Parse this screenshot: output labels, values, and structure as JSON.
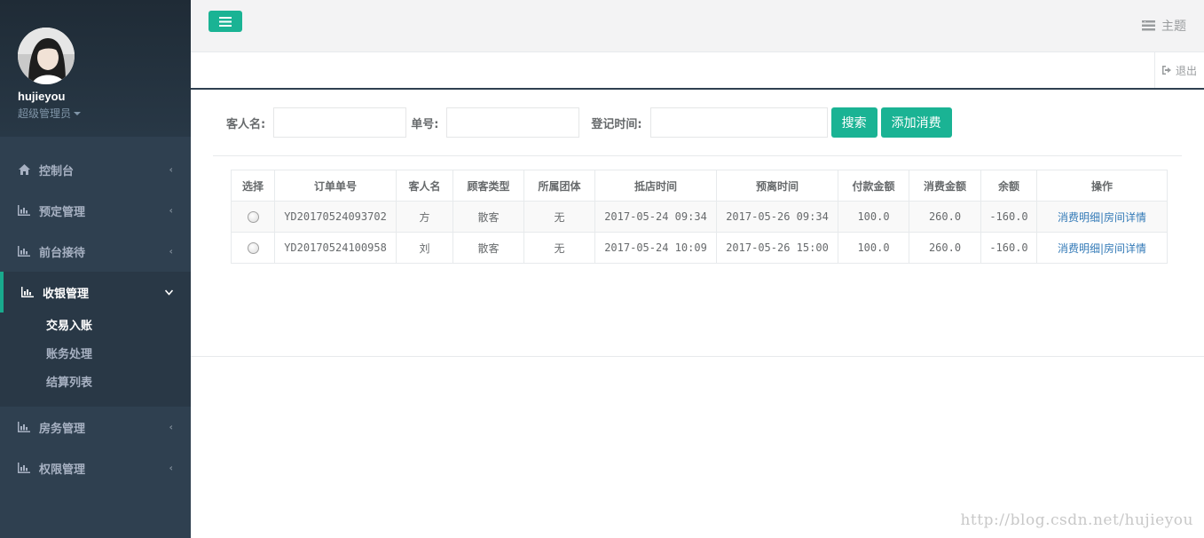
{
  "user": {
    "name": "hujieyou",
    "role": "超级管理员"
  },
  "nav": {
    "items": [
      {
        "label": "控制台",
        "icon": "home-icon"
      },
      {
        "label": "预定管理",
        "icon": "bar-chart-icon"
      },
      {
        "label": "前台接待",
        "icon": "bar-chart-icon"
      },
      {
        "label": "收银管理",
        "icon": "bar-chart-icon",
        "expanded": true
      },
      {
        "label": "房务管理",
        "icon": "bar-chart-icon"
      },
      {
        "label": "权限管理",
        "icon": "bar-chart-icon"
      }
    ],
    "cashier_sub": [
      "交易入账",
      "账务处理",
      "结算列表"
    ]
  },
  "topbar": {
    "theme_label": "主题",
    "logout_label": "退出"
  },
  "search": {
    "guest_label": "客人名:",
    "order_label": "单号:",
    "time_label": "登记时间:",
    "guest_value": "",
    "order_value": "",
    "time_value": "",
    "search_button": "搜索",
    "add_button": "添加消费"
  },
  "table": {
    "headers": [
      "选择",
      "订单单号",
      "客人名",
      "顾客类型",
      "所属团体",
      "抵店时间",
      "预离时间",
      "付款金额",
      "消费金额",
      "余额",
      "操作"
    ],
    "rows": [
      {
        "order": "YD20170524093702",
        "guest": "方",
        "type": "散客",
        "group": "无",
        "arrive": "2017-05-24 09:34",
        "leave": "2017-05-26 09:34",
        "paid": "100.0",
        "spent": "260.0",
        "balance": "-160.0"
      },
      {
        "order": "YD20170524100958",
        "guest": "刘",
        "type": "散客",
        "group": "无",
        "arrive": "2017-05-24 10:09",
        "leave": "2017-05-26 15:00",
        "paid": "100.0",
        "spent": "260.0",
        "balance": "-160.0"
      }
    ],
    "op_detail": "消费明细",
    "op_sep": "|",
    "op_room": "房间详情"
  },
  "watermark": "http://blog.csdn.net/hujieyou",
  "colors": {
    "accent": "#1ab394",
    "sidebar": "#2f4050",
    "link": "#337ab7"
  }
}
